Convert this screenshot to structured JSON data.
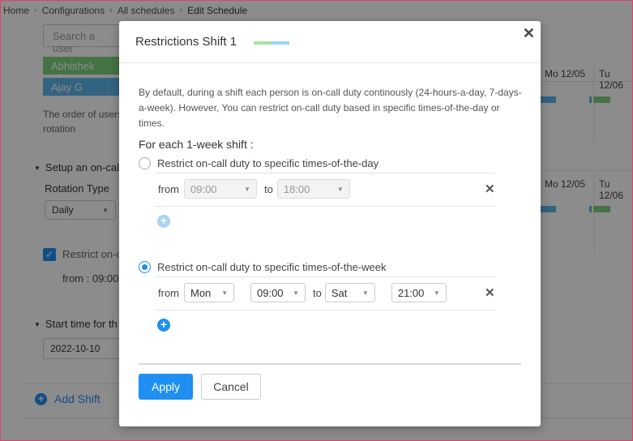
{
  "breadcrumb": [
    "Home",
    "Configurations",
    "All schedules",
    "Edit Schedule"
  ],
  "background": {
    "search_placeholder": "Search a user",
    "users": [
      "Abhishek Bhuy",
      "Ajay G"
    ],
    "order_note": "The order of users rotation",
    "setup_section": "Setup an on-call",
    "rotation_type_label": "Rotation Type",
    "rotation_type_value": "Daily",
    "restrict_label": "Restrict on-c",
    "from_text": "from : 09:00",
    "start_time_section": "Start time for th",
    "start_date": "2022-10-10",
    "add_shift": "Add Shift",
    "day_headers": [
      "Mo 12/05",
      "Tu 12/06"
    ]
  },
  "modal": {
    "title": "Restrictions Shift 1",
    "tag_colors": [
      "#a6e3a6",
      "#9fd2f5"
    ],
    "description": "By default, during a shift each person is on-call duty continously (24-hours-a-day, 7-days-a-week). However, You can restrict on-call duty based in specific times-of-the-day or times.",
    "each_shift": "For each 1-week shift :",
    "option_day": {
      "label": "Restrict on-call duty to specific times-of-the-day",
      "selected": false,
      "from_label": "from",
      "from_time": "09:00",
      "to_label": "to",
      "to_time": "18:00"
    },
    "option_week": {
      "label": "Restrict on-call duty to specific times-of-the-week",
      "selected": true,
      "from_label": "from",
      "from_day": "Mon",
      "from_time": "09:00",
      "to_label": "to",
      "to_day": "Sat",
      "to_time": "21:00"
    },
    "apply_label": "Apply",
    "cancel_label": "Cancel",
    "accent": "#1f8ff2"
  }
}
